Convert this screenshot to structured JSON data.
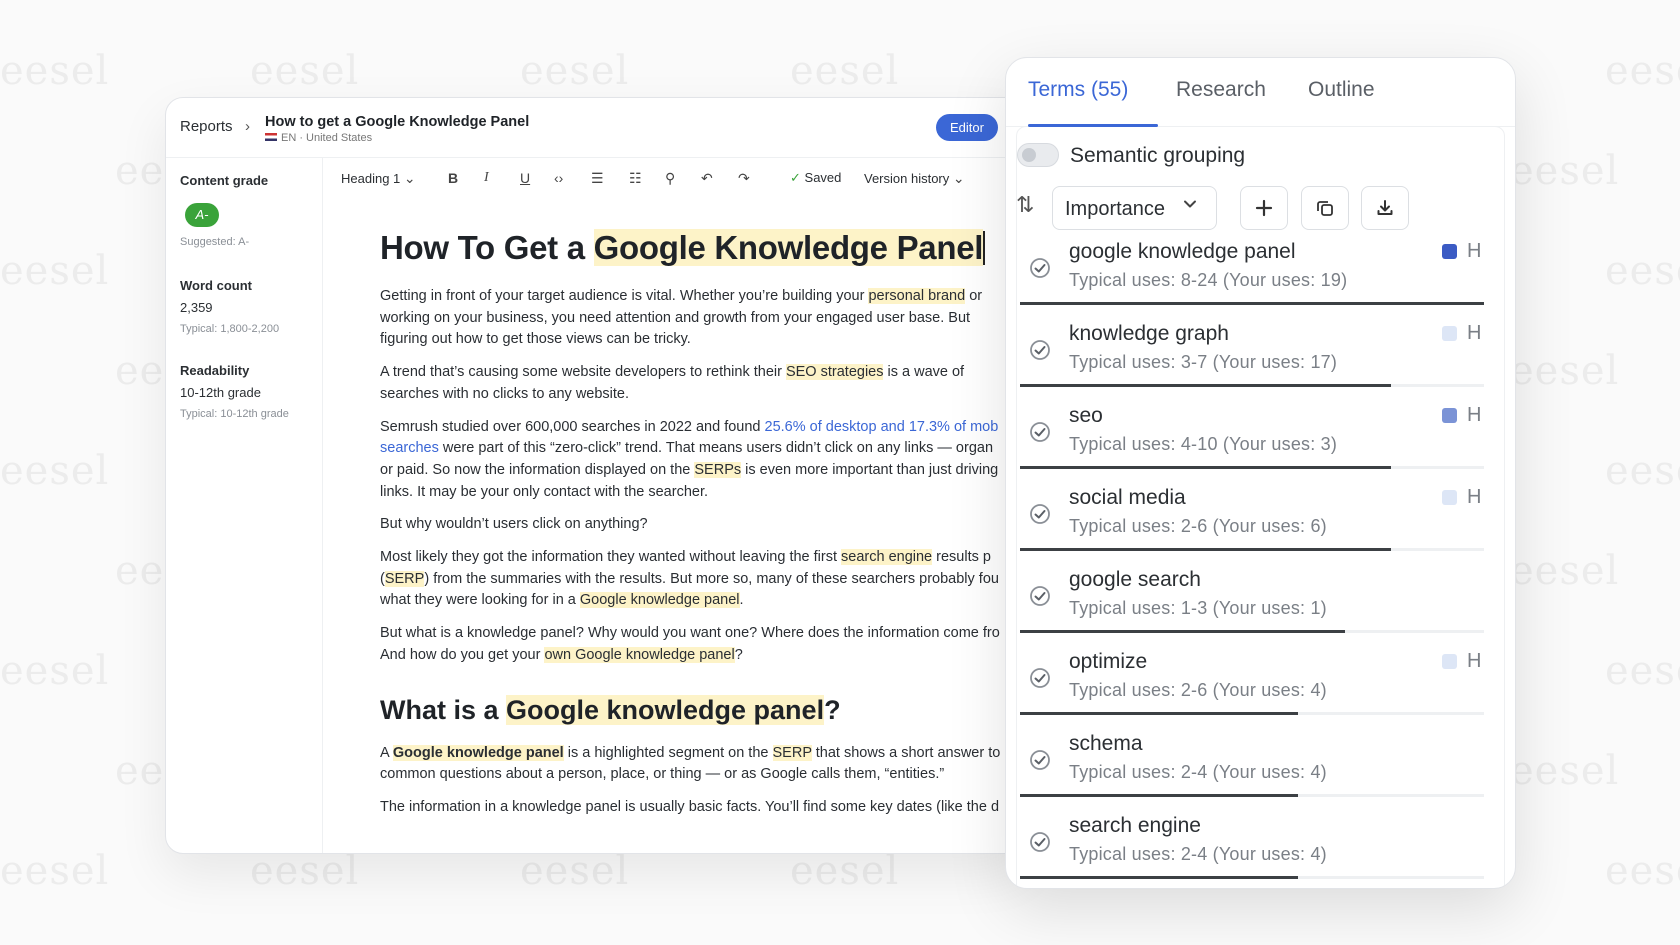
{
  "watermark": "eesel",
  "editor": {
    "breadcrumb": "Reports",
    "doc_title": "How to get a Google Knowledge Panel",
    "locale": "EN · United States",
    "mode_button": "Editor",
    "sidebar": {
      "content_grade_label": "Content grade",
      "grade": "A-",
      "suggested": "Suggested: A-",
      "word_count_label": "Word count",
      "word_count": "2,359",
      "word_typical": "Typical: 1,800-2,200",
      "readability_label": "Readability",
      "readability": "10-12th grade",
      "readability_typical": "Typical: 10-12th grade"
    },
    "toolbar": {
      "block_style": "Heading 1",
      "saved": "Saved",
      "version_history": "Version history"
    },
    "article": {
      "h1_a": "How To Get a ",
      "h1_hl": "Google Knowledge Panel",
      "p1_a": "Getting in front of your target audience is vital. Whether you’re building your ",
      "p1_hl": "personal brand",
      "p1_b": " or",
      "p1_c": "working on your business, you need attention and growth from your engaged user base. But",
      "p1_d": "figuring out how to get those views can be tricky.",
      "p2_a": "A trend that’s causing some website developers to rethink their ",
      "p2_hl": "SEO strategies",
      "p2_b": " is a wave of",
      "p2_c": "searches with no clicks to any website.",
      "p3_a": "Semrush studied over 600,000 searches in 2022 and found ",
      "p3_link1": "25.6% of desktop and 17.3% of mob",
      "p3_link2": "searches",
      "p3_b": " were part of this “zero-click” trend. That means users didn’t click on any links — organ",
      "p3_c": "or paid. So now the information displayed on the ",
      "p3_hl": "SERPs",
      "p3_d": " is even more important than just driving",
      "p3_e": "links. It may be your only contact with the searcher.",
      "p4": "But why wouldn’t users click on anything?",
      "p5_a": "Most likely they got the information they wanted without leaving the first ",
      "p5_hl": "search engine",
      "p5_b": " results p",
      "p5_c_open": "(",
      "p5_c_hl": "SERP",
      "p5_c": ") from the summaries with the results. But more so, many of these searchers probably fou",
      "p5_d": "what they were looking for in a ",
      "p5_d_hl": "Google knowledge panel",
      "p5_d_end": ".",
      "p6_a": "But what is a knowledge panel? Why would you want one? Where does the information come fro",
      "p6_b": "And how do you get your ",
      "p6_hl": "own Google knowledge panel",
      "p6_c": "?",
      "h2_a": "What is a ",
      "h2_hl": "Google knowledge panel",
      "h2_b": "?",
      "p7_a": "A ",
      "p7_hl": "Google knowledge panel",
      "p7_b": " is a highlighted segment on the ",
      "p7_hl2": "SERP",
      "p7_c": " that shows a short answer to",
      "p7_d": "common questions about a person, place, or thing — or as Google calls them, “entities.”",
      "p8": "The information in a knowledge panel is usually basic facts. You’ll find some key dates (like the d"
    }
  },
  "terms_panel": {
    "tabs": [
      "Terms (55)",
      "Research",
      "Outline"
    ],
    "active_tab": 0,
    "semantic_grouping_label": "Semantic grouping",
    "semantic_grouping_on": false,
    "sort_label": "Importance",
    "terms": [
      {
        "name": "google knowledge panel",
        "uses": "Typical uses: 8-24 (Your uses: 19)",
        "fill": 1.0,
        "square": "#3b5bc4",
        "h": "H"
      },
      {
        "name": "knowledge graph",
        "uses": "Typical uses: 3-7 (Your uses: 17)",
        "fill": 0.8,
        "square": "#dde6f6",
        "h": "H"
      },
      {
        "name": "seo",
        "uses": "Typical uses: 4-10 (Your uses: 3)",
        "fill": 0.8,
        "square": "#7b93d6",
        "h": "H"
      },
      {
        "name": "social media",
        "uses": "Typical uses: 2-6 (Your uses: 6)",
        "fill": 0.8,
        "square": "#dde6f6",
        "h": "H"
      },
      {
        "name": "google search",
        "uses": "Typical uses: 1-3 (Your uses: 1)",
        "fill": 0.7,
        "square": "",
        "h": ""
      },
      {
        "name": "optimize",
        "uses": "Typical uses: 2-6 (Your uses: 4)",
        "fill": 0.6,
        "square": "#dde6f6",
        "h": "H"
      },
      {
        "name": "schema",
        "uses": "Typical uses: 2-4 (Your uses: 4)",
        "fill": 0.6,
        "square": "",
        "h": ""
      },
      {
        "name": "search engine",
        "uses": "Typical uses: 2-4 (Your uses: 4)",
        "fill": 0.6,
        "square": "",
        "h": ""
      }
    ]
  }
}
